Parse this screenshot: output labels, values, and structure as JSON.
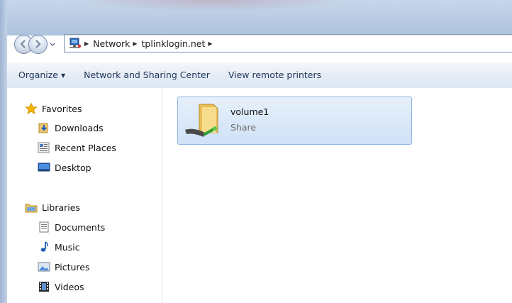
{
  "address": {
    "crumbs": [
      "Network",
      "tplinklogin.net"
    ]
  },
  "toolbar": {
    "organize_label": "Organize",
    "sharing_center_label": "Network and Sharing Center",
    "remote_printers_label": "View remote printers"
  },
  "sidebar": {
    "favorites": {
      "label": "Favorites",
      "items": [
        {
          "label": "Downloads",
          "icon": "downloads-icon"
        },
        {
          "label": "Recent Places",
          "icon": "recent-places-icon"
        },
        {
          "label": "Desktop",
          "icon": "desktop-icon"
        }
      ]
    },
    "libraries": {
      "label": "Libraries",
      "items": [
        {
          "label": "Documents",
          "icon": "documents-icon"
        },
        {
          "label": "Music",
          "icon": "music-icon"
        },
        {
          "label": "Pictures",
          "icon": "pictures-icon"
        },
        {
          "label": "Videos",
          "icon": "videos-icon"
        }
      ]
    }
  },
  "content": {
    "items": [
      {
        "name": "volume1",
        "type": "Share",
        "icon": "shared-folder-icon"
      }
    ]
  },
  "colors": {
    "selection_border": "#8fb4e0",
    "selection_fill": "#cfe2f7",
    "command_text": "#1e3656"
  }
}
